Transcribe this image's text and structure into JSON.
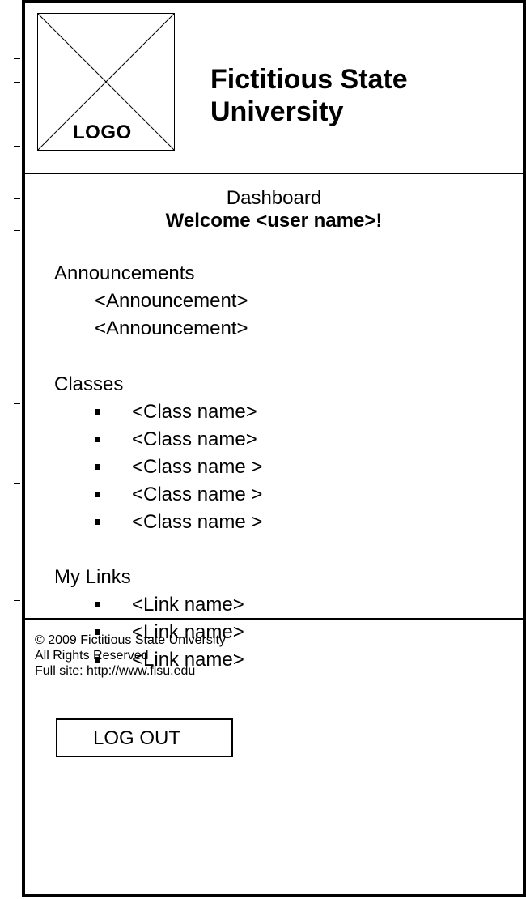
{
  "header": {
    "logo_label": "LOGO",
    "title": "Fictitious State University"
  },
  "main": {
    "page_title": "Dashboard",
    "welcome": "Welcome <user name>!",
    "announcements": {
      "heading": "Announcements",
      "items": [
        "<Announcement>",
        "<Announcement>"
      ]
    },
    "classes": {
      "heading": "Classes",
      "items": [
        "<Class name>",
        "<Class name>",
        "<Class name >",
        "<Class name >",
        "<Class name >"
      ]
    },
    "links": {
      "heading": "My Links",
      "items": [
        "<Link name>",
        "<Link name>",
        "<Link name>"
      ]
    },
    "logout_label": "LOG OUT"
  },
  "footer": {
    "copyright": "© 2009 Fictitious State University",
    "rights": "All Rights Reserved",
    "full_site": "Full site: http://www.fisu.edu"
  },
  "icons": {
    "logo": "logo-placeholder-icon",
    "bullet": "square-bullet-icon"
  },
  "colors": {
    "line": "#000000",
    "background": "#ffffff"
  }
}
